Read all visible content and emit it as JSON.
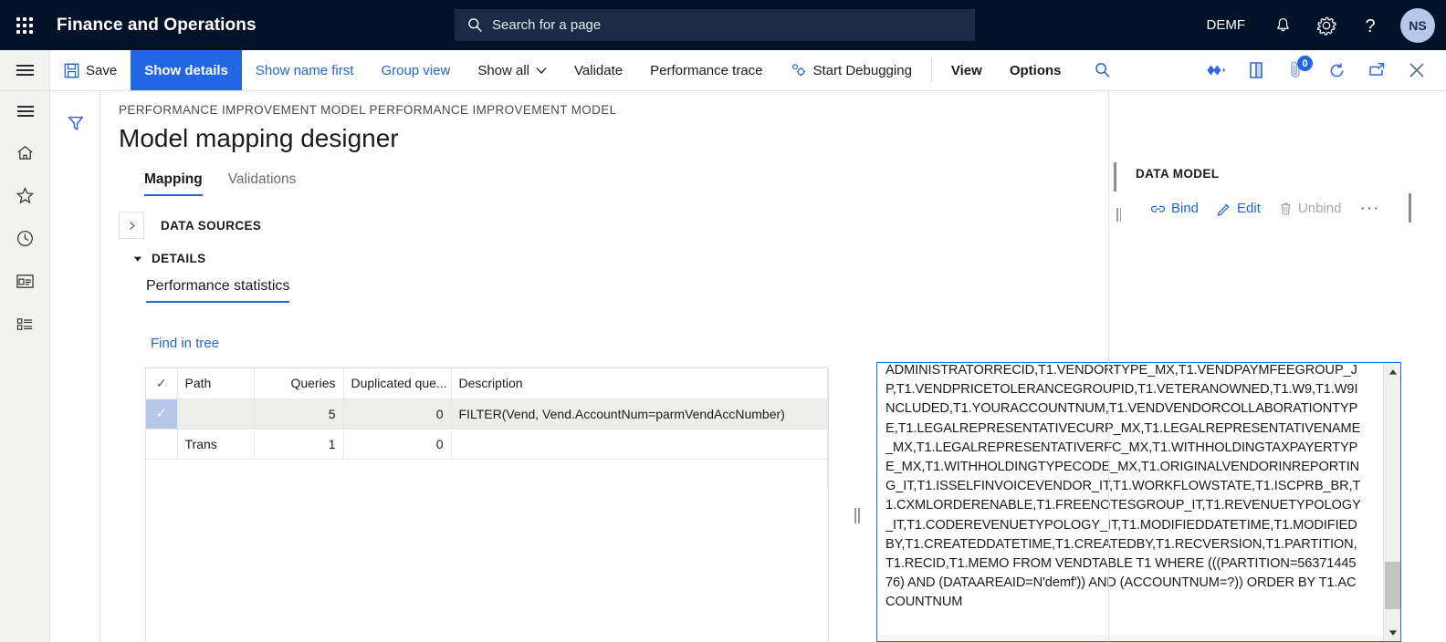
{
  "topbar": {
    "waffle_icon": "waffle-grid-icon",
    "brand": "Finance and Operations",
    "search_placeholder": "Search for a page",
    "search_icon": "search-icon",
    "company": "DEMF",
    "notification_icon": "bell-icon",
    "settings_icon": "gear-icon",
    "help_icon": "question-mark-icon",
    "avatar_initials": "NS"
  },
  "toolbar": {
    "hamburger_icon": "hamburger-menu-icon",
    "save_label": "Save",
    "save_icon": "save-disk-icon",
    "show_details_label": "Show details",
    "show_name_first_label": "Show name first",
    "group_view_label": "Group view",
    "show_all_label": "Show all",
    "show_all_chevron": "chevron-down-icon",
    "validate_label": "Validate",
    "performance_trace_label": "Performance trace",
    "start_debugging_label": "Start Debugging",
    "start_debugging_icon": "debug-gears-icon",
    "view_label": "View",
    "options_label": "Options",
    "search_icon": "search-icon",
    "right_icons": [
      {
        "name": "diamonds-icon"
      },
      {
        "name": "open-in-new-window-icon"
      },
      {
        "name": "attachments-icon",
        "badge": "0"
      },
      {
        "name": "refresh-icon"
      },
      {
        "name": "share-icon"
      },
      {
        "name": "close-icon"
      }
    ]
  },
  "left_rail": {
    "items": [
      {
        "name": "hamburger-menu-icon"
      },
      {
        "name": "home-icon"
      },
      {
        "name": "favorites-star-icon"
      },
      {
        "name": "recent-clock-icon"
      },
      {
        "name": "workspaces-icon"
      },
      {
        "name": "modules-list-icon"
      }
    ]
  },
  "filter_column": {
    "filter_icon": "filter-funnel-icon"
  },
  "page": {
    "breadcrumb": "PERFORMANCE IMPROVEMENT MODEL PERFORMANCE IMPROVEMENT MODEL",
    "title": "Model mapping designer",
    "tabs": [
      {
        "label": "Mapping",
        "selected": true
      },
      {
        "label": "Validations",
        "selected": false
      }
    ],
    "data_sources_label": "DATA SOURCES",
    "data_sources_expander_icon": "chevron-right-icon",
    "details_label": "DETAILS",
    "details_expander_icon": "chevron-down-icon",
    "performance_statistics_tab": "Performance statistics",
    "find_in_tree_link": "Find in tree"
  },
  "grid": {
    "columns": [
      "Path",
      "Queries",
      "Duplicated que...",
      "Description"
    ],
    "check_header_icon": "checkmark-icon",
    "rows": [
      {
        "selected": true,
        "check_icon": "checkmark-icon",
        "path": "",
        "queries": "5",
        "duplicated": "0",
        "description": "FILTER(Vend, Vend.AccountNum=parmVendAccNumber)"
      },
      {
        "selected": false,
        "check_icon": "",
        "path": "Trans",
        "queries": "1",
        "duplicated": "0",
        "description": ""
      }
    ]
  },
  "sql_panel": {
    "text": "ADMINISTRATORRECID,T1.VENDORTYPE_MX,T1.VENDPAYMFEEGROUP_JP,T1.VENDPRICETOLERANCEGROUPID,T1.VETERANOWNED,T1.W9,T1.W9INCLUDED,T1.YOURACCOUNTNUM,T1.VENDVENDORCOLLABORATIONTYPE,T1.LEGALREPRESENTATIVECURP_MX,T1.LEGALREPRESENTATIVENAME_MX,T1.LEGALREPRESENTATIVERFC_MX,T1.WITHHOLDINGTAXPAYERTYPE_MX,T1.WITHHOLDINGTYPECODE_MX,T1.ORIGINALVENDORINREPORTING_IT,T1.ISSELFINVOICEVENDOR_IT,T1.WORKFLOWSTATE,T1.ISCPRB_BR,T1.CXMLORDERENABLE,T1.FREENOTESGROUP_IT,T1.REVENUETYPOLOGY_IT,T1.CODEREVENUETYPOLOGY_IT,T1.MODIFIEDDATETIME,T1.MODIFIEDBY,T1.CREATEDDATETIME,T1.CREATEDBY,T1.RECVERSION,T1.PARTITION,T1.RECID,T1.MEMO FROM VENDTABLE T1 WHERE (((PARTITION=5637144576) AND (DATAAREAID=N'demf')) AND (ACCOUNTNUM=?)) ORDER BY T1.ACCOUNTNUM",
    "scroll_up_icon": "triangle-up-icon",
    "scroll_down_icon": "triangle-down-icon",
    "splitter_icon": "vertical-splitter-handle"
  },
  "data_model": {
    "title": "DATA MODEL",
    "bind_label": "Bind",
    "bind_icon": "link-chain-icon",
    "edit_label": "Edit",
    "edit_icon": "pencil-icon",
    "unbind_label": "Unbind",
    "unbind_icon": "trash-bin-icon",
    "more_label": "···"
  },
  "colors": {
    "nav_bg": "#031229",
    "accent": "#2266e3",
    "link": "#2266cc",
    "selected_row": "#ededeb",
    "selected_check": "#b7c7e8"
  }
}
